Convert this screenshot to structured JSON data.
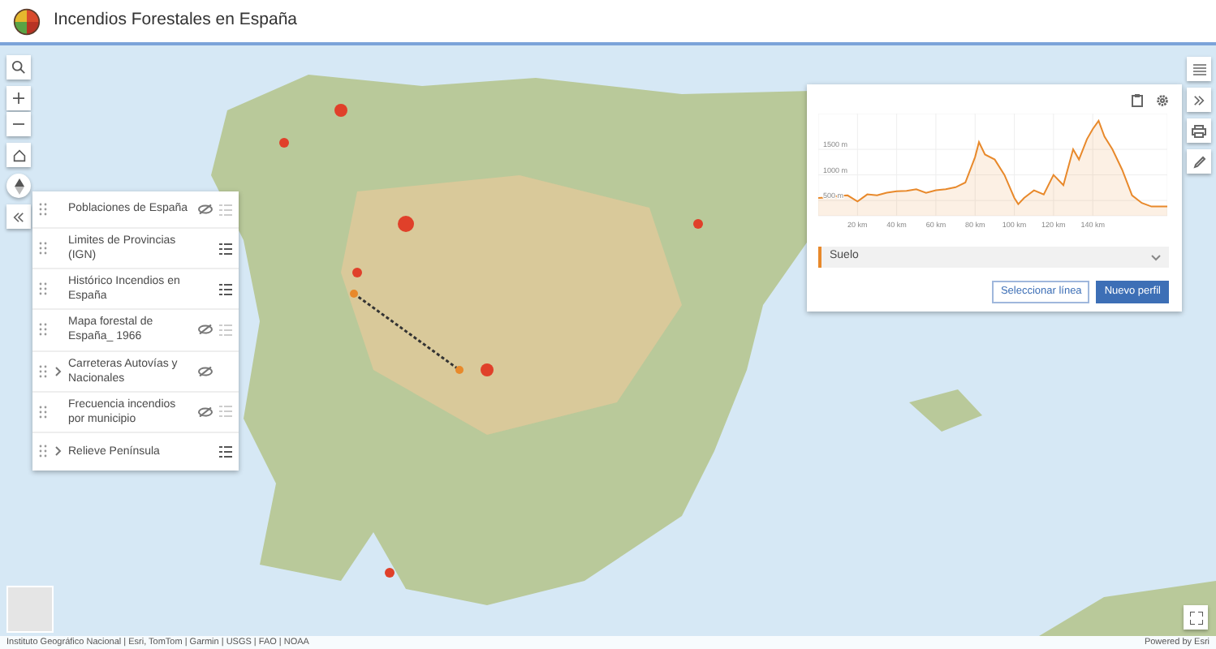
{
  "header": {
    "title": "Incendios Forestales en España"
  },
  "layers": [
    {
      "name": "Poblaciones de España",
      "visible": false,
      "expandable": false,
      "legend": true
    },
    {
      "name": "Limites de Provincias (IGN)",
      "visible": true,
      "expandable": false,
      "legend": true
    },
    {
      "name": "Histórico Incendios en España",
      "visible": true,
      "expandable": false,
      "legend": true
    },
    {
      "name": "Mapa forestal de España_ 1966",
      "visible": false,
      "expandable": false,
      "legend": true
    },
    {
      "name": "Carreteras Autovías y Nacionales",
      "visible": false,
      "expandable": true,
      "legend": false
    },
    {
      "name": "Frecuencia incendios por municipio",
      "visible": false,
      "expandable": false,
      "legend": true
    },
    {
      "name": "Relieve Península",
      "visible": true,
      "expandable": true,
      "legend": true
    }
  ],
  "profile": {
    "chart_data": {
      "type": "area",
      "grid": true,
      "xlim": [
        0,
        178
      ],
      "ylim": [
        200,
        2200
      ],
      "xticks": [
        {
          "value": 20,
          "label": "20 km"
        },
        {
          "value": 40,
          "label": "40 km"
        },
        {
          "value": 60,
          "label": "60 km"
        },
        {
          "value": 80,
          "label": "80 km"
        },
        {
          "value": 100,
          "label": "100 km"
        },
        {
          "value": 120,
          "label": "120 km"
        },
        {
          "value": 140,
          "label": "140 km"
        }
      ],
      "yticks": [
        {
          "value": 500,
          "label": "500 m"
        },
        {
          "value": 1000,
          "label": "1000 m"
        },
        {
          "value": 1500,
          "label": "1500 m"
        }
      ],
      "x": [
        0,
        5,
        10,
        15,
        20,
        25,
        30,
        35,
        40,
        45,
        50,
        55,
        60,
        65,
        70,
        75,
        80,
        82,
        85,
        90,
        95,
        100,
        102,
        105,
        110,
        115,
        120,
        125,
        130,
        133,
        137,
        140,
        143,
        146,
        150,
        155,
        160,
        165,
        170,
        178
      ],
      "series": [
        {
          "name": "Suelo",
          "color": "#e8892b",
          "values": [
            550,
            560,
            590,
            600,
            480,
            620,
            600,
            650,
            680,
            690,
            720,
            650,
            700,
            720,
            760,
            850,
            1350,
            1640,
            1400,
            1300,
            1000,
            550,
            430,
            550,
            700,
            620,
            1000,
            800,
            1500,
            1300,
            1700,
            1900,
            2060,
            1750,
            1500,
            1100,
            600,
            450,
            380,
            380
          ]
        }
      ]
    },
    "buttons": [
      {
        "label": "Seleccionar línea",
        "kind": "outline"
      },
      {
        "label": "Nuevo perfil",
        "kind": "primary"
      }
    ]
  },
  "attribution": {
    "sources": "Instituto Geográfico Nacional | Esri, TomTom | Garmin | USGS | FAO | NOAA",
    "powered": "Powered by Esri"
  }
}
